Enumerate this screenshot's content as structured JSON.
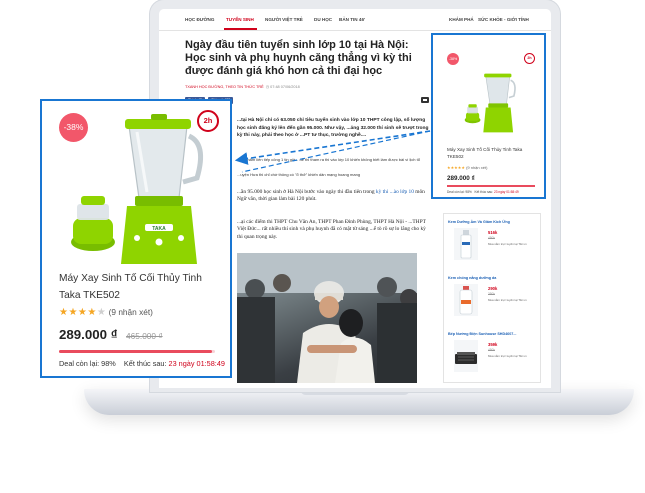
{
  "nav": {
    "items": [
      "HỌC ĐƯỜNG",
      "TUYỂN SINH",
      "NGƯỜI VIỆT TRẺ",
      "DU HỌC",
      "BẢN TIN 46'"
    ],
    "right_items": [
      "KHÁM PHÁ",
      "SỨC KHỎE - GIỚI TÍNH"
    ],
    "active_index": 1
  },
  "article": {
    "title": "Ngày đầu tiên tuyển sinh lớp 10 tại Hà Nội: Học sinh và phụ huynh căng thẳng vì kỳ thi được đánh giá khó hơn cả thi đại học",
    "meta_tag": "TXANH HỌC ĐƯỜNG, THEO TIN THỨC TRẺ",
    "meta_time": "07:48 07/06/2018",
    "share_like": "Thích 45",
    "share_share": "Chia sẻ 477",
    "summary": "...tại Hà Nội chỉ có 63.050 chỉ tiêu tuyển sinh vào lớp 10 THPT công lập, số lượng học sinh đăng ký lên đến gần 95.000. Như vậy, ...ảng 32.000 thí sinh sẽ trượt trong kỳ thi này, phải theo học ở ...PT tư thục, trường nghề....",
    "related_1": "...ừ 2 năm liên tiếp công 1 tin giả... đề thi tham ra thi vào lớp 10 khiến không biết làm được bài vì lịch tổ",
    "related_2": "...uyện Hưa thi chỉ chớ thông có \"ổ thở\" khiến dân mạng hoang mang",
    "body_1_before": "...ần 95.000 học sinh ở Hà Nội bước vào ngày thi đầu tiên trong ",
    "body_1_link": "kỳ thi ...ào lớp 10",
    "body_1_after": " môn Ngữ văn, thời gian làm bài 120 phút.",
    "body_2": "...ại các điểm thi THPT Chu Văn An, THPT Phan Đình Phùng, THPT Hà Nội - ...THPT Việt Đức... rất nhiều thí sinh và phụ huynh đã có mặt từ sáng ...ể tò rõ sự lo lắng cho kỳ thi quan trọng này."
  },
  "mini_card": {
    "discount": "-38%",
    "badge": "2h",
    "name": "Máy Xay Sinh Tố Cối Thủy Tinh Taka TKE502",
    "reviews": "(9 nhận xét)",
    "price": "289.000 ₫",
    "deal_left": "Deal còn lại: 98%",
    "deal_end_label": "Kết thúc sau:",
    "deal_end_value": "23 ngày 01:58:49"
  },
  "sidebar_ad": {
    "items": [
      {
        "title": "Kem Dưỡng Ẩm Và Giảm Kích Ứng",
        "price": "516k",
        "old": "450k",
        "note": "Mua sắm trực tuyến tại Tiki.vn"
      },
      {
        "title": "Kem chống nắng dưỡng da",
        "price": "290k",
        "old": "350k",
        "note": "Mua sắm trực tuyến tại Tiki.vn"
      },
      {
        "title": "Bếp Nướng Điện Sunhouse SHD4607...",
        "price": "359k",
        "old": "450k",
        "note": "Mua sắm trực tuyến tại Tiki.vn"
      }
    ]
  },
  "zoom_card": {
    "discount": "-38%",
    "badge": "2h",
    "name": "Máy Xay Sinh Tố Cối Thủy Tinh Taka TKE502",
    "stars": "★★★★",
    "star_half": "★",
    "reviews": "(9 nhận xét)",
    "price": "289.000 ₫",
    "old_price": "465.000 ₫",
    "deal_left": "Deal còn lại: 98%",
    "deal_end_label": "Kết thúc sau:",
    "deal_end_value": "23 ngày 01:58:49",
    "deal_progress": 0.98,
    "brand": "TAKA"
  },
  "colors": {
    "accent_blue": "#1976d2",
    "brand_red": "#d0021b",
    "sale_pink": "#f2576a",
    "blender_green": "#8fd400",
    "star_yellow": "#f5a623"
  }
}
